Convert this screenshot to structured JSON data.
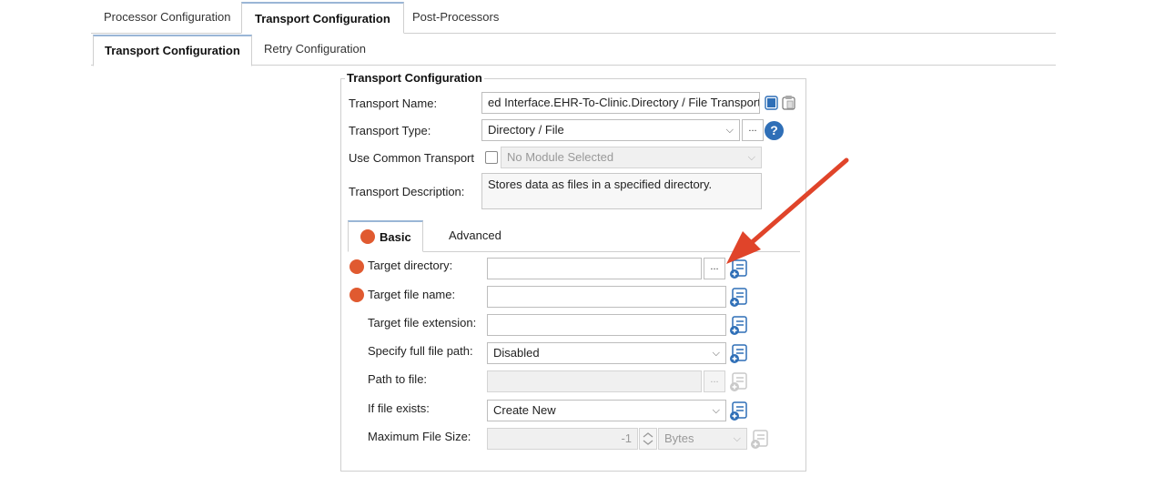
{
  "top_tabs": [
    "Processor Configuration",
    "Transport Configuration",
    "Post-Processors"
  ],
  "sub_tabs": [
    "Transport Configuration",
    "Retry Configuration"
  ],
  "group": {
    "title": "Transport Configuration",
    "transport_name_label": "Transport Name:",
    "transport_name_value": "ed Interface.EHR-To-Clinic.Directory / File Transport",
    "transport_type_label": "Transport Type:",
    "transport_type_value": "Directory / File",
    "use_common_label": "Use Common Transport",
    "common_module_value": "No Module Selected",
    "description_label": "Transport Description:",
    "description_value": "Stores data as files in a specified directory.",
    "help_symbol": "?",
    "dots": "..."
  },
  "inner_tabs": [
    "Basic",
    "Advanced"
  ],
  "basic": {
    "target_directory_label": "Target directory:",
    "target_directory_value": "",
    "target_file_name_label": "Target file name:",
    "target_file_name_value": "",
    "target_file_ext_label": "Target file extension:",
    "target_file_ext_value": "",
    "full_path_label": "Specify full file path:",
    "full_path_value": "Disabled",
    "path_to_file_label": "Path to file:",
    "path_to_file_value": "",
    "if_exists_label": "If file exists:",
    "if_exists_value": "Create New",
    "max_size_label": "Maximum File Size:",
    "max_size_value": "-1",
    "max_size_unit": "Bytes"
  },
  "colors": {
    "accent": "#2f6fb7",
    "required": "#e05a30",
    "arrow": "#e0442a"
  }
}
